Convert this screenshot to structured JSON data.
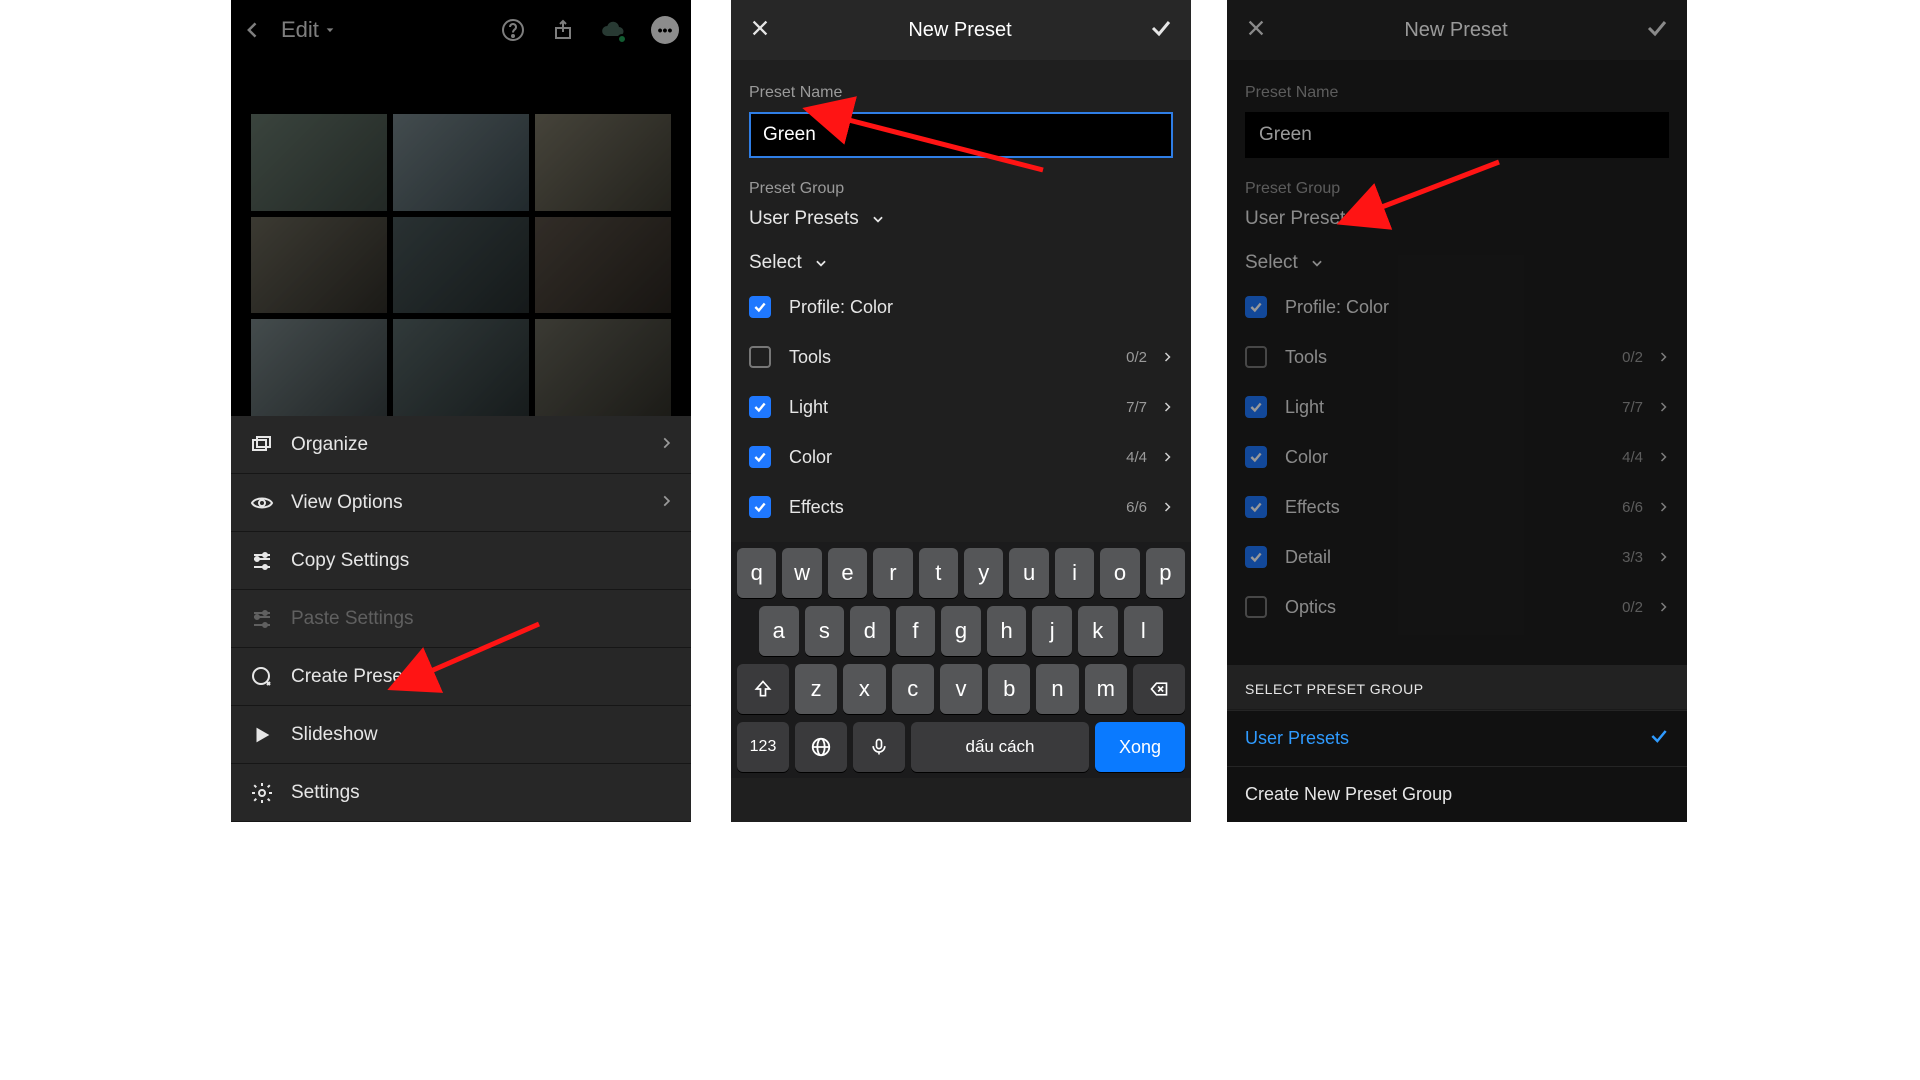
{
  "screen1": {
    "mode_label": "Edit",
    "menu": {
      "organize": "Organize",
      "view_options": "View Options",
      "copy_settings": "Copy Settings",
      "paste_settings": "Paste Settings",
      "create_preset": "Create Preset",
      "slideshow": "Slideshow",
      "settings": "Settings"
    }
  },
  "screen2": {
    "title": "New Preset",
    "preset_name_label": "Preset Name",
    "preset_name_value": "Green",
    "preset_group_label": "Preset Group",
    "preset_group_value": "User Presets",
    "select_label": "Select",
    "items": {
      "profile": "Profile: Color",
      "tools": "Tools",
      "tools_count": "0/2",
      "light": "Light",
      "light_count": "7/7",
      "color": "Color",
      "color_count": "4/4",
      "effects": "Effects",
      "effects_count": "6/6"
    },
    "keyboard": {
      "row1": [
        "q",
        "w",
        "e",
        "r",
        "t",
        "y",
        "u",
        "i",
        "o",
        "p"
      ],
      "row2": [
        "a",
        "s",
        "d",
        "f",
        "g",
        "h",
        "j",
        "k",
        "l"
      ],
      "row3": [
        "z",
        "x",
        "c",
        "v",
        "b",
        "n",
        "m"
      ],
      "mode_key": "123",
      "space_key": "dấu cách",
      "done_key": "Xong"
    }
  },
  "screen3": {
    "title": "New Preset",
    "preset_name_label": "Preset Name",
    "preset_name_value": "Green",
    "preset_group_label": "Preset Group",
    "preset_group_value": "User Presets",
    "select_label": "Select",
    "items": {
      "profile": "Profile: Color",
      "tools": "Tools",
      "tools_count": "0/2",
      "light": "Light",
      "light_count": "7/7",
      "color": "Color",
      "color_count": "4/4",
      "effects": "Effects",
      "effects_count": "6/6",
      "detail": "Detail",
      "detail_count": "3/3",
      "optics": "Optics",
      "optics_count": "0/2"
    },
    "sheet": {
      "title": "SELECT PRESET GROUP",
      "option_user": "User Presets",
      "option_new": "Create New Preset Group"
    }
  }
}
